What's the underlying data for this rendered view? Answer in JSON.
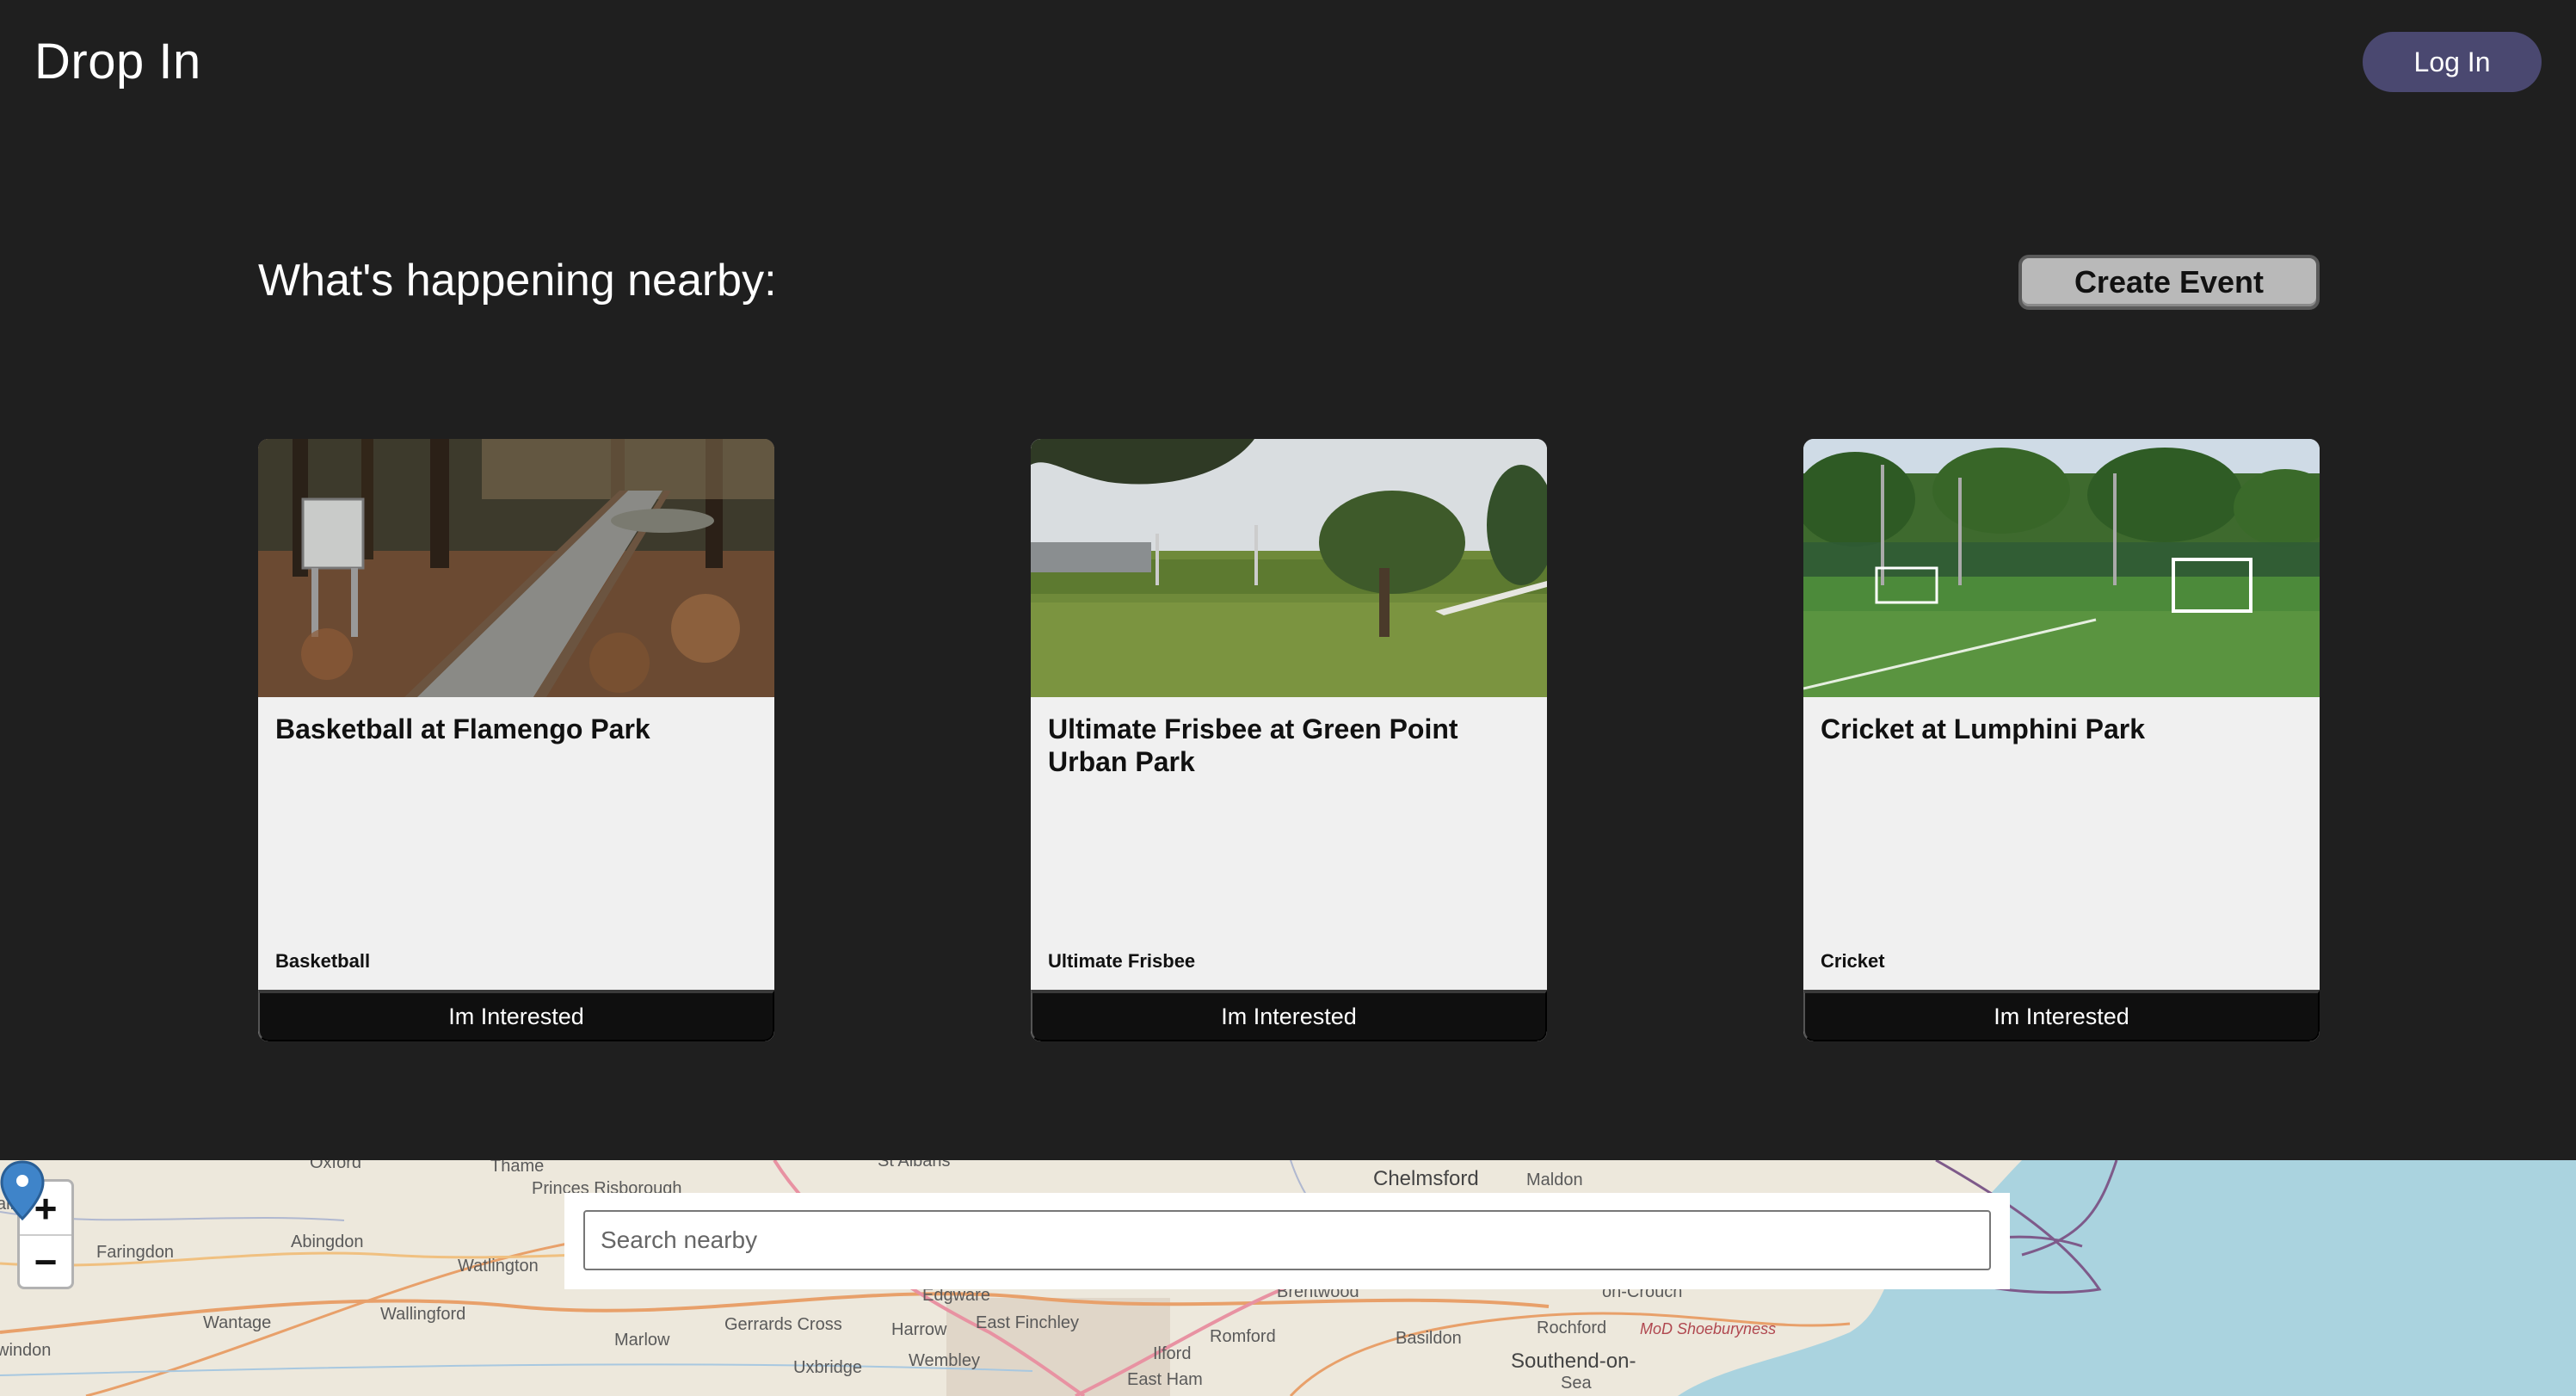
{
  "header": {
    "brand": "Drop In",
    "login_label": "Log In"
  },
  "main": {
    "section_title": "What's happening nearby:",
    "create_event_label": "Create Event",
    "events": [
      {
        "title": "Basketball at Flamengo Park",
        "sport": "Basketball",
        "interest_label": "Im Interested",
        "image": "park-path-image"
      },
      {
        "title": "Ultimate Frisbee at Green Point Urban Park",
        "sport": "Ultimate Frisbee",
        "interest_label": "Im Interested",
        "image": "green-park-tree-image"
      },
      {
        "title": "Cricket at Lumphini Park",
        "sport": "Cricket",
        "interest_label": "Im Interested",
        "image": "football-pitch-image"
      }
    ]
  },
  "map": {
    "zoom_in": "+",
    "zoom_out": "−",
    "search_placeholder": "Search nearby",
    "places": [
      "Oxford",
      "Thame",
      "St Albans",
      "Chelmsford",
      "Maldon",
      "Princes Risborough",
      "Abingdon",
      "Faringdon",
      "Watlington",
      "Edgware",
      "Brentwood",
      "on-Crouch",
      "Wantage",
      "Wallingford",
      "Gerrards Cross",
      "Harrow",
      "East Finchley",
      "Romford",
      "Basildon",
      "Rochford",
      "MoD Shoeburyness",
      "Marlow",
      "Uxbridge",
      "Wembley",
      "Ilford",
      "East Ham",
      "Southend-on-",
      "Sea",
      "windon",
      "airf"
    ]
  }
}
